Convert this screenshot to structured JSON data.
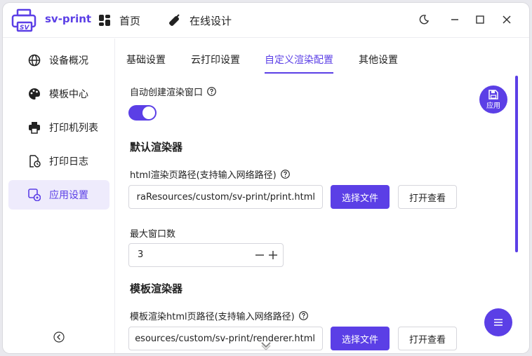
{
  "app": {
    "name": "sv-print"
  },
  "topnav": {
    "home": "首页",
    "design": "在线设计"
  },
  "sidebar": {
    "items": [
      {
        "label": "设备概况"
      },
      {
        "label": "模板中心"
      },
      {
        "label": "打印机列表"
      },
      {
        "label": "打印日志"
      },
      {
        "label": "应用设置"
      }
    ]
  },
  "tabs": [
    {
      "label": "基础设置"
    },
    {
      "label": "云打印设置"
    },
    {
      "label": "自定义渲染配置"
    },
    {
      "label": "其他设置"
    }
  ],
  "settings": {
    "auto_window_label": "自动创建渲染窗口",
    "auto_window_enabled": true,
    "default_renderer_title": "默认渲染器",
    "html_path_label": "html渲染页路径(支持输入网络路径)",
    "html_path_value": "raResources/custom/sv-print/print.html",
    "choose_file": "选择文件",
    "open_view": "打开查看",
    "max_windows_label": "最大窗口数",
    "max_windows_value": "3",
    "template_renderer_title": "模板渲染器",
    "template_path_label": "模板渲染html页路径(支持输入网络路径)",
    "template_path_value": "esources/custom/sv-print/renderer.html"
  },
  "fab": {
    "apply": "应用"
  },
  "colors": {
    "accent": "#5b3fe6"
  }
}
